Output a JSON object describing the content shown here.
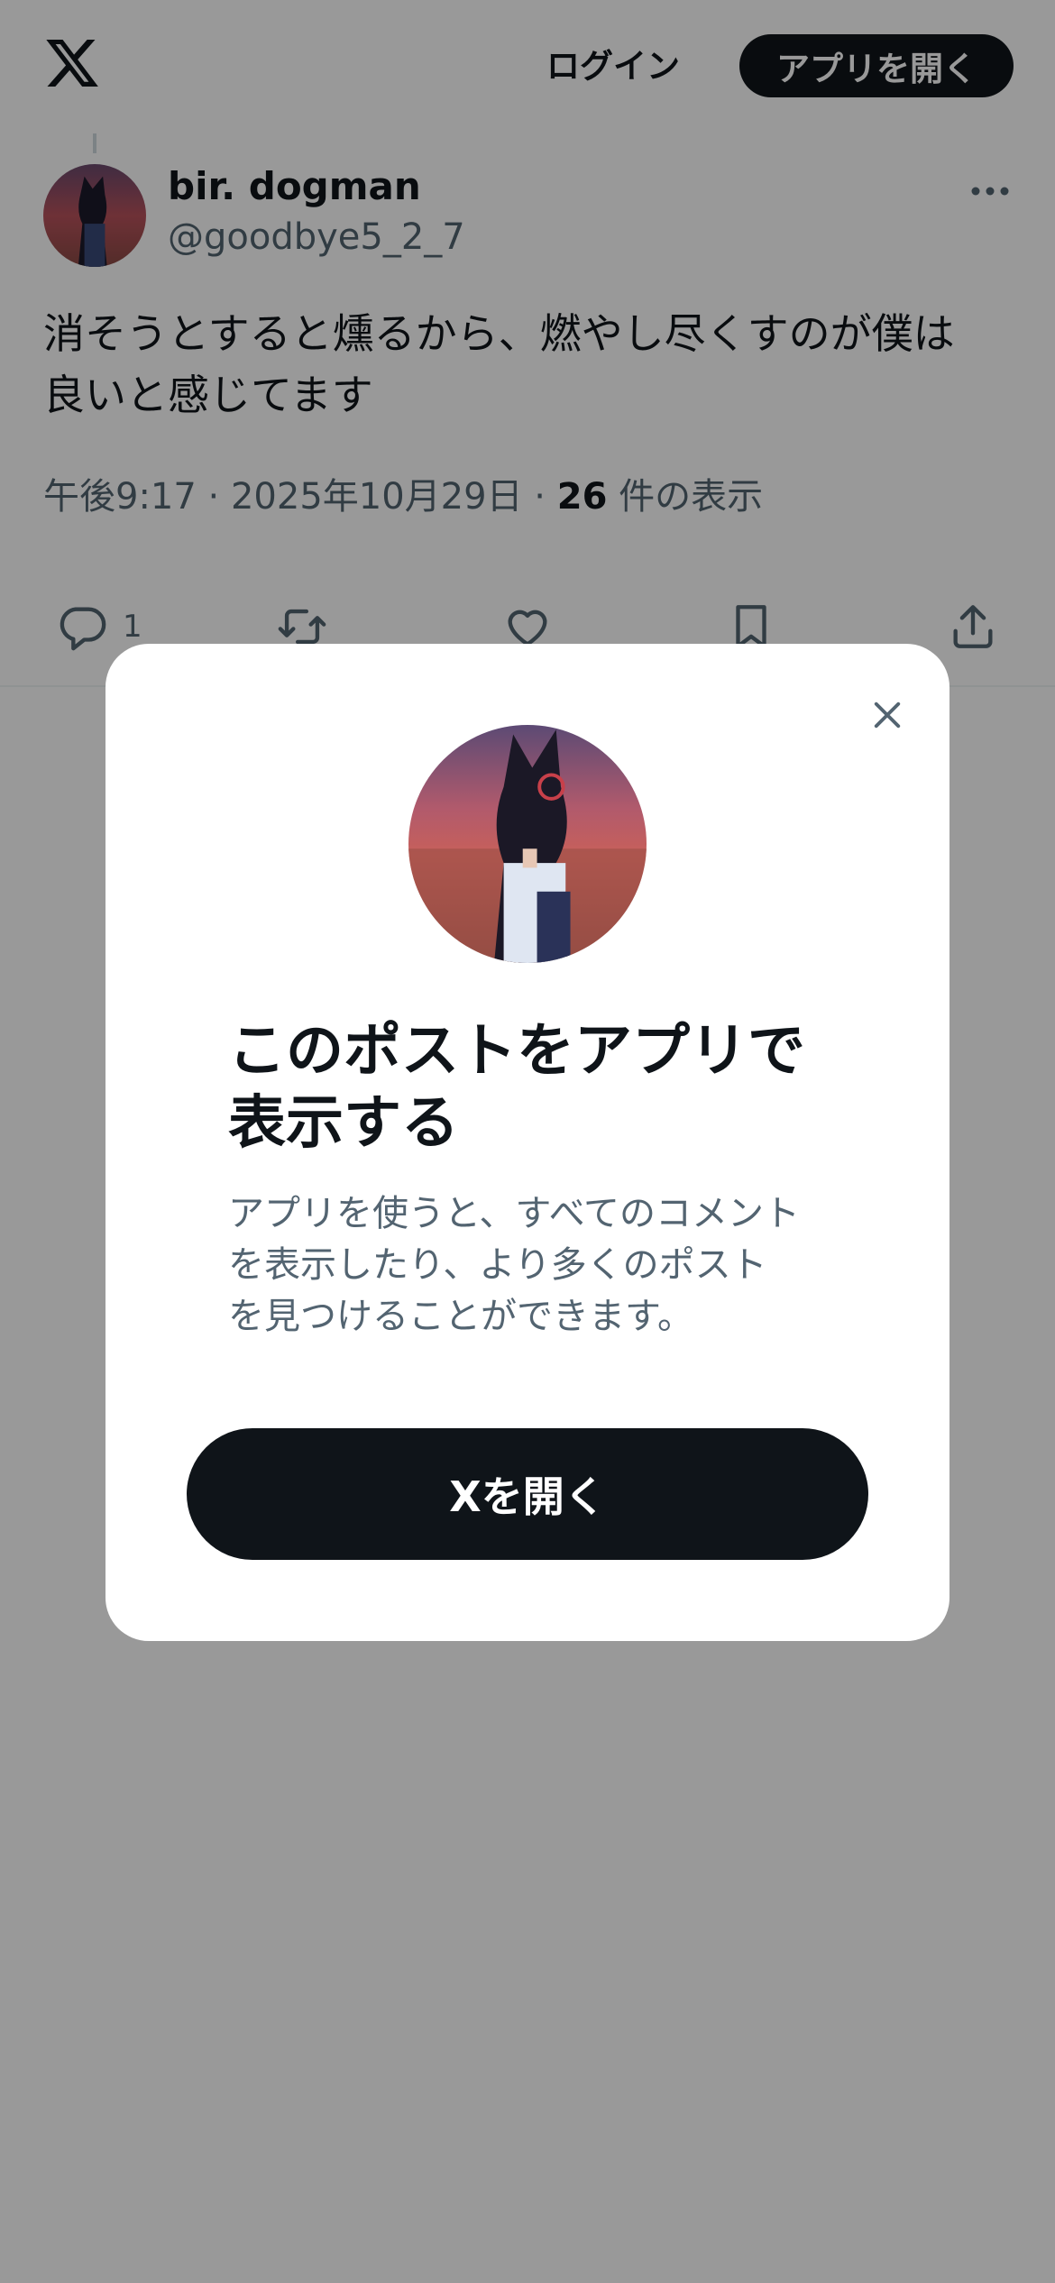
{
  "header": {
    "logo_icon": "x-logo-icon",
    "login_label": "ログイン",
    "open_app_label": "アプリを開く"
  },
  "tweet": {
    "author_name": "bir. dogman",
    "author_handle": "@goodbye5_2_7",
    "more_icon": "more-horizontal-icon",
    "text_line1": "消そうとすると燻るから、燃やし尽くすのが僕は",
    "text_line2": "良いと感じてます",
    "time": "午後9:17",
    "sep": "·",
    "date": "2025年10月29日",
    "views_count": "26",
    "views_label": "件の表示",
    "actions": {
      "reply_icon": "reply-icon",
      "reply_count": "1",
      "retweet_icon": "retweet-icon",
      "like_icon": "heart-icon",
      "bookmark_icon": "bookmark-icon",
      "share_icon": "share-icon"
    }
  },
  "modal": {
    "close_icon": "close-icon",
    "title_line1": "このポストをアプリで",
    "title_line2": "表示する",
    "desc_line1": "アプリを使うと、すべてのコメント",
    "desc_line2": "を表示したり、より多くのポスト",
    "desc_line3": "を見つけることができます。",
    "cta_label": "Xを開く"
  },
  "colors": {
    "text_primary": "#0f1419",
    "text_secondary": "#536471",
    "button_dark": "#0f1419",
    "overlay": "rgba(0,0,0,0.4)"
  }
}
